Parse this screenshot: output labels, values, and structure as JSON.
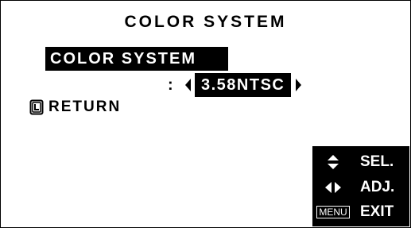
{
  "osd": {
    "title": "COLOR SYSTEM",
    "selected_item": "COLOR SYSTEM",
    "separator": ":",
    "value": "3.58NTSC",
    "return_label": "RETURN",
    "help": {
      "sel_label": "SEL.",
      "adj_label": "ADJ.",
      "menu_key": "MENU",
      "exit_label": "EXIT"
    }
  }
}
